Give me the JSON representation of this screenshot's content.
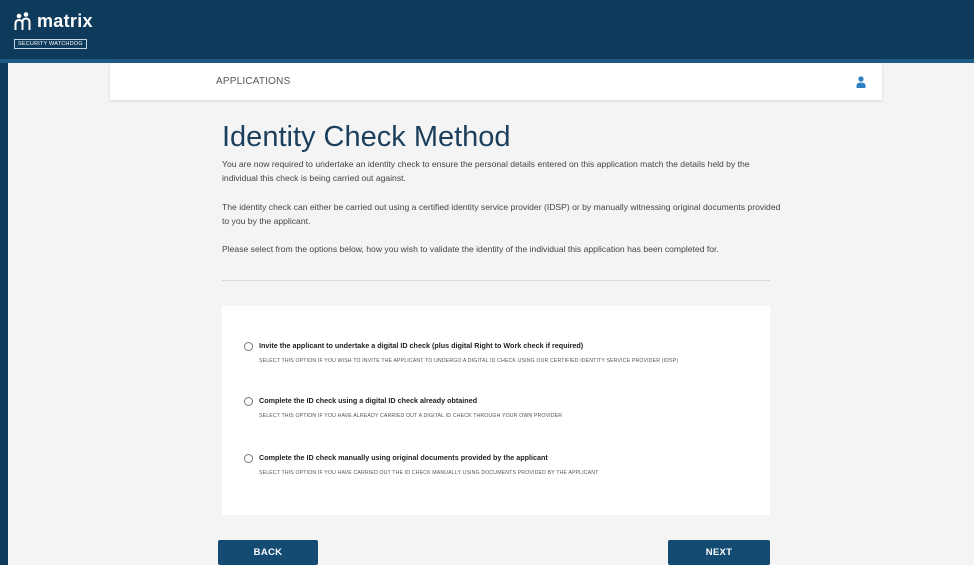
{
  "brand": {
    "name": "matrix",
    "tagline": "SECURITY WATCHDOG"
  },
  "header": {
    "section": "APPLICATIONS",
    "user_icon": "user-icon"
  },
  "page": {
    "title": "Identity Check Method",
    "paragraphs": [
      "You are now required to undertake an identity check to ensure the personal details entered on this application match the details held by the individual this check is being carried out against.",
      "The identity check can either be carried out using a certified identity service provider (IDSP) or by manually witnessing original documents provided to you by the applicant.",
      "Please select from the options below, how you wish to validate the identity of the individual this application has been completed for."
    ]
  },
  "options": [
    {
      "label": "Invite the applicant to undertake a digital ID check (plus digital Right to Work check if required)",
      "description": "SELECT THIS OPTION IF YOU WISH TO INVITE THE APPLICANT TO UNDERGO A DIGITAL ID CHECK USING OUR CERTIFIED IDENTITY SERVICE PROVIDER (IDSP)"
    },
    {
      "label": "Complete the ID check using a digital ID check already obtained",
      "description": "SELECT THIS OPTION IF YOU HAVE ALREADY CARRIED OUT A DIGITAL ID CHECK THROUGH YOUR OWN PROVIDER"
    },
    {
      "label": "Complete the ID check manually using original documents provided by the applicant",
      "description": "SELECT THIS OPTION IF YOU HAVE CARRIED OUT THE ID CHECK MANUALLY USING DOCUMENTS PROVIDED BY THE APPLICANT"
    }
  ],
  "buttons": {
    "back": "BACK",
    "next": "NEXT"
  },
  "colors": {
    "topbar": "#0e3a5c",
    "primary_button": "#134b72",
    "title": "#1b3f5c"
  }
}
